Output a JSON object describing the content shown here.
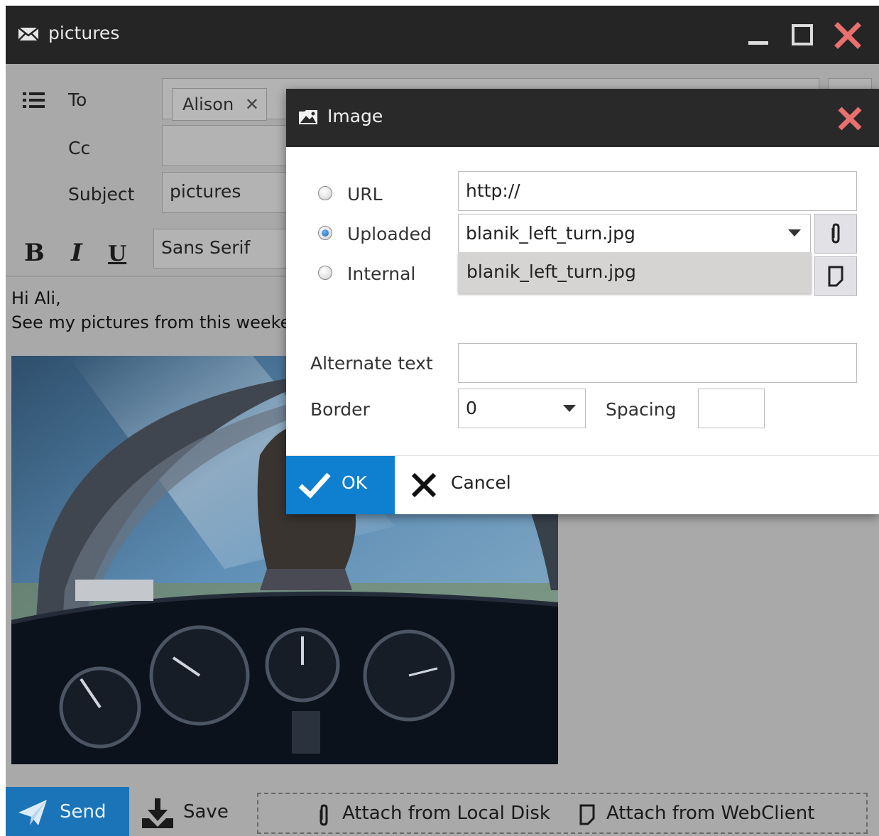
{
  "window": {
    "title": "pictures",
    "icon": "envelope-icon"
  },
  "compose": {
    "to_label": "To",
    "cc_label": "Cc",
    "subject_label": "Subject",
    "recipient": "Alison",
    "subject_value": "pictures",
    "font_value": "Sans Serif",
    "bold": "B",
    "italic": "I",
    "underline": "U",
    "body_line1": "Hi Ali,",
    "body_line2": "See my pictures from this weeken"
  },
  "bottom": {
    "send": "Send",
    "save": "Save",
    "attach_local": "Attach from Local Disk",
    "attach_web": "Attach from WebClient"
  },
  "dialog": {
    "title": "Image",
    "url_label": "URL",
    "uploaded_label": "Uploaded",
    "internal_label": "Internal",
    "url_value": "http://",
    "uploaded_value": "blanik_left_turn.jpg",
    "dropdown_options": [
      "blanik_left_turn.jpg"
    ],
    "selected_source": "Uploaded",
    "alt_label": "Alternate text",
    "alt_value": "",
    "border_label": "Border",
    "border_value": "0",
    "spacing_label": "Spacing",
    "spacing_value": "",
    "ok": "OK",
    "cancel": "Cancel"
  },
  "colors": {
    "accent": "#0f7fcf",
    "close_red": "#e8706e",
    "titlebar": "#252525"
  }
}
